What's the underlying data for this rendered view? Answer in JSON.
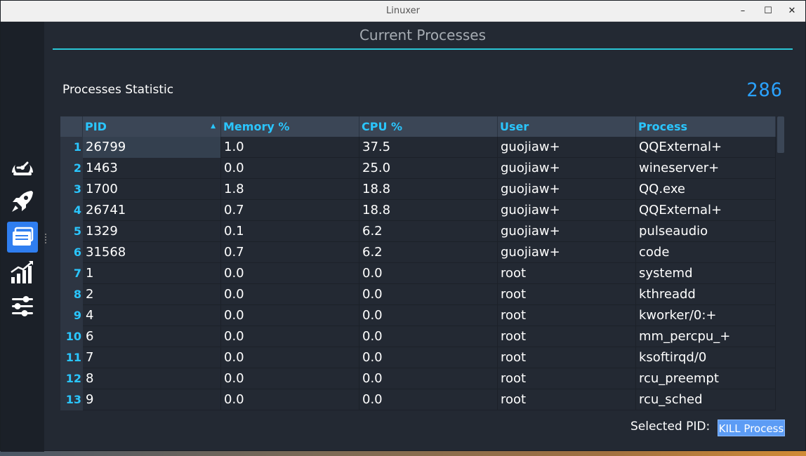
{
  "window": {
    "title": "Linuxer"
  },
  "header": {
    "title": "Current Processes"
  },
  "stats": {
    "label": "Processes Statistic",
    "count": "286"
  },
  "table": {
    "columns": [
      "PID",
      "Memory %",
      "CPU %",
      "User",
      "Process"
    ],
    "rows": [
      {
        "num": "1",
        "pid": "26799",
        "mem": "1.0",
        "cpu": "37.5",
        "user": "guojiaw+",
        "proc": "QQExternal+"
      },
      {
        "num": "2",
        "pid": "1463",
        "mem": "0.0",
        "cpu": "25.0",
        "user": "guojiaw+",
        "proc": "wineserver+"
      },
      {
        "num": "3",
        "pid": "1700",
        "mem": "1.8",
        "cpu": "18.8",
        "user": "guojiaw+",
        "proc": "QQ.exe"
      },
      {
        "num": "4",
        "pid": "26741",
        "mem": "0.7",
        "cpu": "18.8",
        "user": "guojiaw+",
        "proc": "QQExternal+"
      },
      {
        "num": "5",
        "pid": "1329",
        "mem": "0.1",
        "cpu": "6.2",
        "user": "guojiaw+",
        "proc": "pulseaudio"
      },
      {
        "num": "6",
        "pid": "31568",
        "mem": "0.7",
        "cpu": "6.2",
        "user": "guojiaw+",
        "proc": "code"
      },
      {
        "num": "7",
        "pid": "1",
        "mem": "0.0",
        "cpu": "0.0",
        "user": "root",
        "proc": "systemd"
      },
      {
        "num": "8",
        "pid": "2",
        "mem": "0.0",
        "cpu": "0.0",
        "user": "root",
        "proc": "kthreadd"
      },
      {
        "num": "9",
        "pid": "4",
        "mem": "0.0",
        "cpu": "0.0",
        "user": "root",
        "proc": "kworker/0:+"
      },
      {
        "num": "10",
        "pid": "6",
        "mem": "0.0",
        "cpu": "0.0",
        "user": "root",
        "proc": "mm_percpu_+"
      },
      {
        "num": "11",
        "pid": "7",
        "mem": "0.0",
        "cpu": "0.0",
        "user": "root",
        "proc": "ksoftirqd/0"
      },
      {
        "num": "12",
        "pid": "8",
        "mem": "0.0",
        "cpu": "0.0",
        "user": "root",
        "proc": "rcu_preempt"
      },
      {
        "num": "13",
        "pid": "9",
        "mem": "0.0",
        "cpu": "0.0",
        "user": "root",
        "proc": "rcu_sched"
      }
    ]
  },
  "footer": {
    "selected_label": "Selected PID:",
    "kill_label": "KILL Process"
  },
  "sidebar": {
    "items": [
      {
        "icon": "speedometer-icon"
      },
      {
        "icon": "rocket-icon"
      },
      {
        "icon": "processes-icon",
        "active": true
      },
      {
        "icon": "chart-icon"
      },
      {
        "icon": "sliders-icon"
      }
    ]
  },
  "colors": {
    "accent": "#2ac6ff",
    "active": "#2f7ef0",
    "count": "#2aa2ff",
    "divider": "#2ac6d6"
  }
}
